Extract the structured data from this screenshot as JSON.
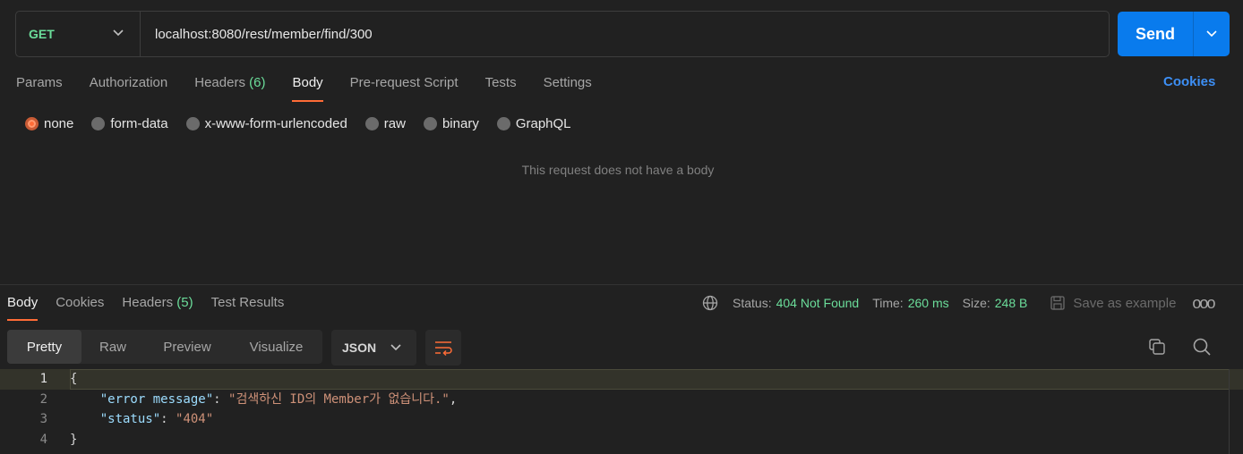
{
  "request": {
    "method": "GET",
    "url": "localhost:8080/rest/member/find/300",
    "send_label": "Send"
  },
  "request_tabs": [
    {
      "label": "Params"
    },
    {
      "label": "Authorization"
    },
    {
      "label": "Headers",
      "count": "(6)"
    },
    {
      "label": "Body"
    },
    {
      "label": "Pre-request Script"
    },
    {
      "label": "Tests"
    },
    {
      "label": "Settings"
    }
  ],
  "cookies_label": "Cookies",
  "body_types": [
    "none",
    "form-data",
    "x-www-form-urlencoded",
    "raw",
    "binary",
    "GraphQL"
  ],
  "no_body_text": "This request does not have a body",
  "response_tabs": [
    {
      "label": "Body"
    },
    {
      "label": "Cookies"
    },
    {
      "label": "Headers",
      "count": "(5)"
    },
    {
      "label": "Test Results"
    }
  ],
  "status": {
    "status_label": "Status:",
    "status_value": "404 Not Found",
    "time_label": "Time:",
    "time_value": "260 ms",
    "size_label": "Size:",
    "size_value": "248 B",
    "save_label": "Save as example",
    "more": "ooo"
  },
  "view_modes": [
    "Pretty",
    "Raw",
    "Preview",
    "Visualize"
  ],
  "format": "JSON",
  "code": {
    "line_numbers": [
      "1",
      "2",
      "3",
      "4"
    ],
    "open": "{",
    "close": "}",
    "key1": "\"error message\"",
    "val1": "\"검색하신 ID의 Member가 없습니다.\"",
    "key2": "\"status\"",
    "val2": "\"404\""
  },
  "colors": {
    "accent": "#ff6c37",
    "send": "#097bed",
    "green": "#6bdd9a",
    "link": "#3d8ff5"
  }
}
